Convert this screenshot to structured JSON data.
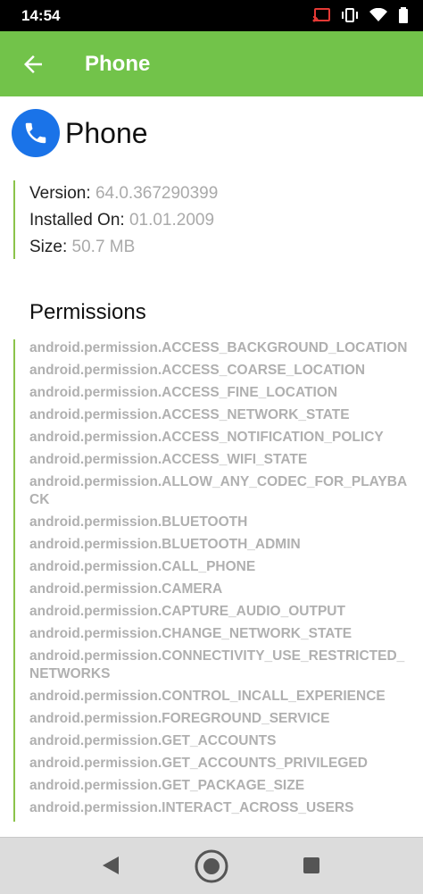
{
  "status": {
    "time": "14:54"
  },
  "appbar": {
    "title": "Phone"
  },
  "app": {
    "name": "Phone"
  },
  "info": {
    "version_label": "Version:",
    "version_value": "64.0.367290399",
    "installed_label": "Installed On:",
    "installed_value": "01.01.2009",
    "size_label": "Size:",
    "size_value": "50.7 MB"
  },
  "permissions_title": "Permissions",
  "permissions": [
    "android.permission.ACCESS_BACKGROUND_LOCATION",
    "android.permission.ACCESS_COARSE_LOCATION",
    "android.permission.ACCESS_FINE_LOCATION",
    "android.permission.ACCESS_NETWORK_STATE",
    "android.permission.ACCESS_NOTIFICATION_POLICY",
    "android.permission.ACCESS_WIFI_STATE",
    "android.permission.ALLOW_ANY_CODEC_FOR_PLAYBACK",
    "android.permission.BLUETOOTH",
    "android.permission.BLUETOOTH_ADMIN",
    "android.permission.CALL_PHONE",
    "android.permission.CAMERA",
    "android.permission.CAPTURE_AUDIO_OUTPUT",
    "android.permission.CHANGE_NETWORK_STATE",
    "android.permission.CONNECTIVITY_USE_RESTRICTED_NETWORKS",
    "android.permission.CONTROL_INCALL_EXPERIENCE",
    "android.permission.FOREGROUND_SERVICE",
    "android.permission.GET_ACCOUNTS",
    "android.permission.GET_ACCOUNTS_PRIVILEGED",
    "android.permission.GET_PACKAGE_SIZE",
    "android.permission.INTERACT_ACROSS_USERS"
  ],
  "colors": {
    "accent": "#72c34a",
    "icon": "#1a73e8"
  }
}
